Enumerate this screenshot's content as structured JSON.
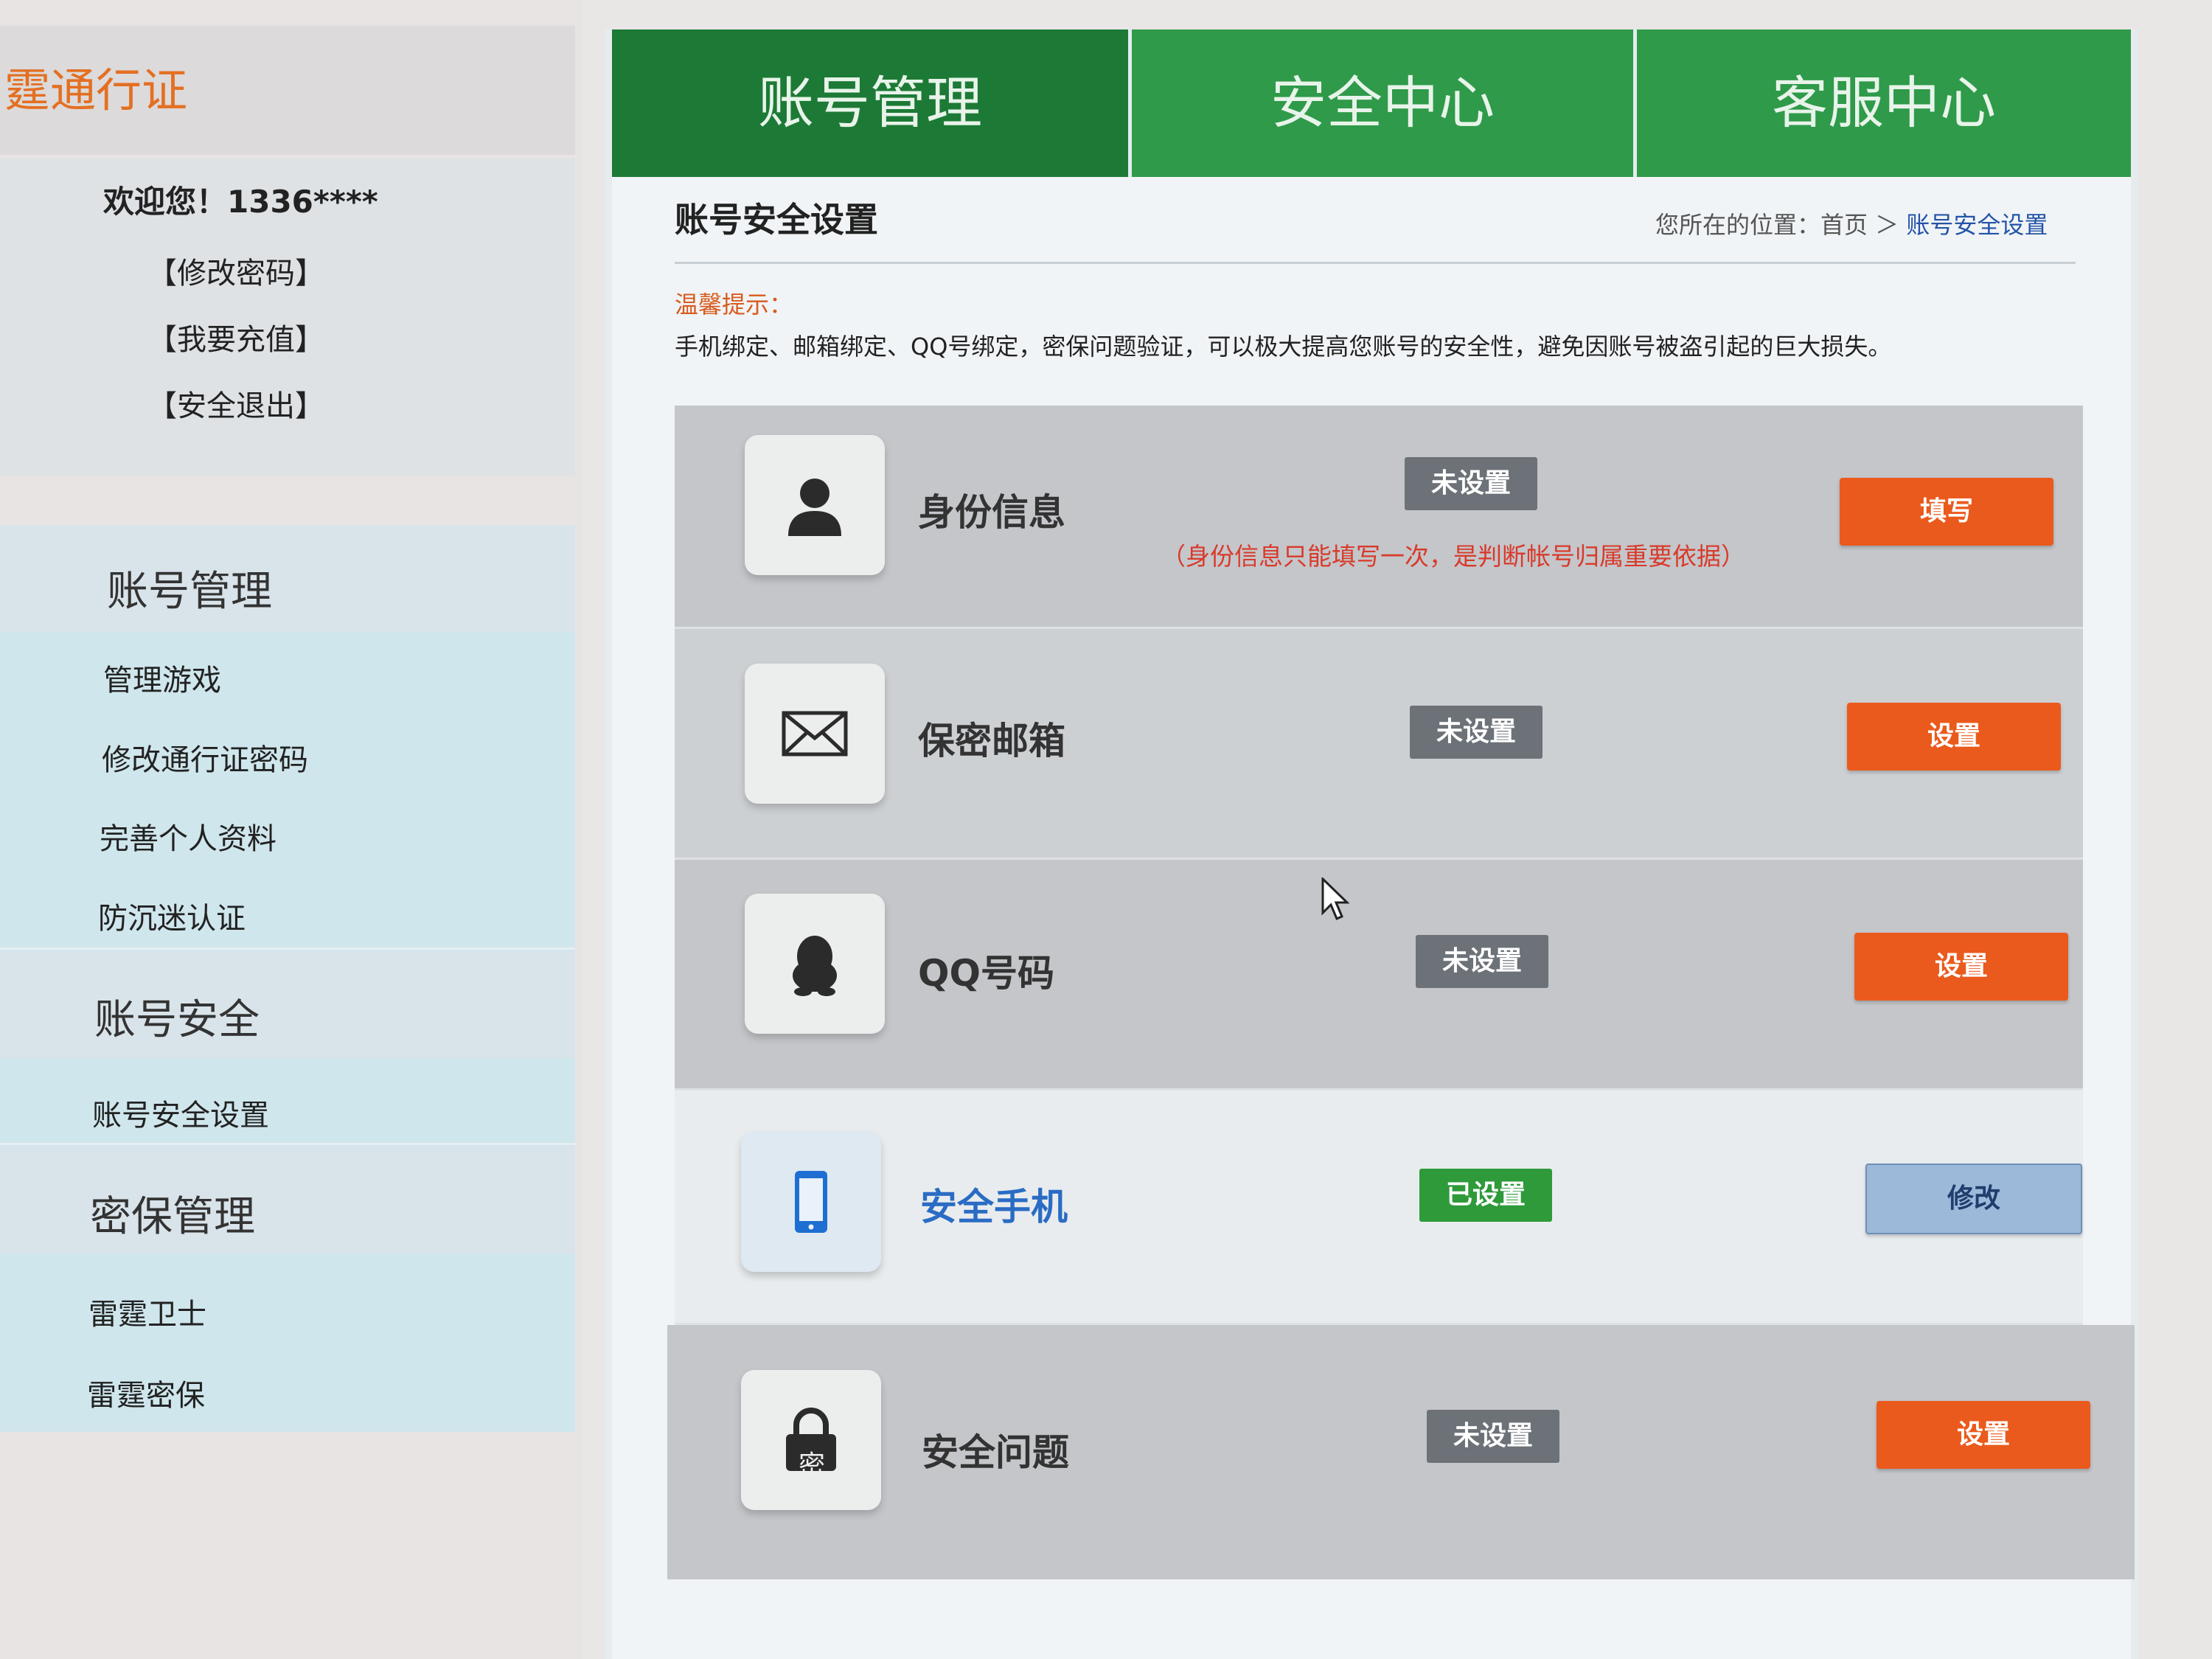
{
  "brand": {
    "title": "霆通行证"
  },
  "user": {
    "welcome": "欢迎您！1336****",
    "links": [
      "【修改密码】",
      "【我要充值】",
      "【安全退出】"
    ]
  },
  "nav": [
    {
      "title": "账号管理",
      "items": [
        "管理游戏",
        "修改通行证密码",
        "完善个人资料",
        "防沉迷认证"
      ]
    },
    {
      "title": "账号安全",
      "items": [
        "账号安全设置"
      ]
    },
    {
      "title": "密保管理",
      "items": [
        "雷霆卫士",
        "雷霆密保"
      ]
    }
  ],
  "tabs": [
    "账号管理",
    "安全中心",
    "客服中心"
  ],
  "page": {
    "title": "账号安全设置",
    "crumb_prefix": "您所在的位置：首页 ＞ ",
    "crumb_current": "账号安全设置",
    "tip_title": "温馨提示：",
    "tip_text": "手机绑定、邮箱绑定、QQ号绑定，密保问题验证，可以极大提高您账号的安全性，避免因账号被盗引起的巨大损失。"
  },
  "rows": [
    {
      "label": "身份信息",
      "status": "未设置",
      "note": "（身份信息只能填写一次，是判断帐号归属重要依据）",
      "action": "填写",
      "icon": "person-icon"
    },
    {
      "label": "保密邮箱",
      "status": "未设置",
      "action": "设置",
      "icon": "envelope-icon"
    },
    {
      "label": "QQ号码",
      "status": "未设置",
      "action": "设置",
      "icon": "penguin-icon"
    },
    {
      "label": "安全手机",
      "status": "已设置",
      "action": "修改",
      "icon": "phone-icon"
    },
    {
      "label": "安全问题",
      "status": "未设置",
      "action": "设置",
      "icon": "lock-icon",
      "icon_text": "密"
    }
  ],
  "colors": {
    "tab_green": "#2f9a4a",
    "tab_active": "#1d7a36",
    "button_orange": "#ea5a1c",
    "status_grey": "#6c7278",
    "status_green": "#2e9a3a",
    "link_blue": "#2454a8"
  }
}
